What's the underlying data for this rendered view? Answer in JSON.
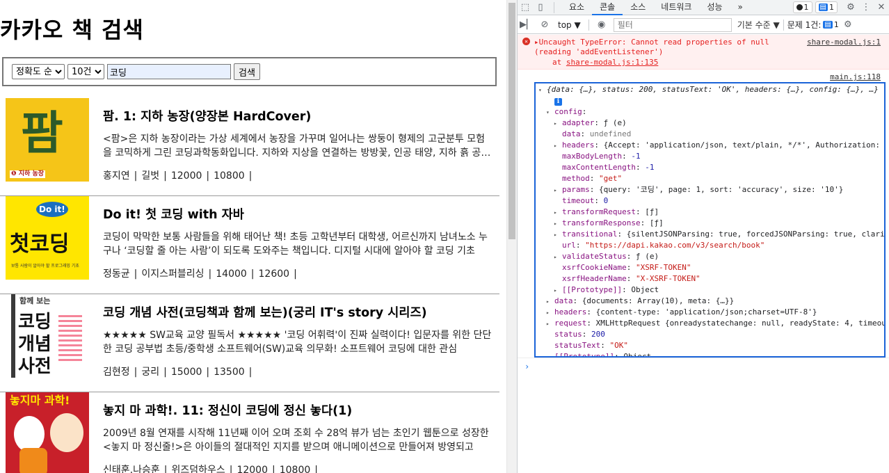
{
  "page": {
    "title": "카카오 책 검색",
    "search": {
      "sort_value": "정확도 순",
      "size_value": "10건",
      "query_value": "코딩",
      "submit_label": "검색"
    },
    "books": [
      {
        "title": "팜. 1: 지하 농장(양장본 HardCover)",
        "desc": "<팜>은 지하 농장이라는 가상 세계에서 농장을 가꾸며 일어나는 쌍둥이 형제의 고군분투 모험을 코믹하게 그린 코딩과학동화입니다. 지하와 지상을 연결하는 방방꽃, 인공 태양, 지하 흙 공장 등",
        "author": "홍지연",
        "publisher": "길벗",
        "price": "12000",
        "sale_price": "10800",
        "cover_text": "팜",
        "cover_sub": "❶ 지하 농장"
      },
      {
        "title": "Do it! 첫 코딩 with 자바",
        "desc": "코딩이 막막한 보통 사람들을 위해 태어난 책! 초등 고학년부터 대학생, 어르신까지 남녀노소 누구나 ‘코딩할 줄 아는 사람’이 되도록 도와주는 책입니다. 디지털 시대에 알아야 할 코딩 기초",
        "author": "정동균",
        "publisher": "이지스퍼블리싱",
        "price": "14000",
        "sale_price": "12600",
        "cover_badge": "Do it!",
        "cover_text": "첫코딩",
        "cover_sub": "보통 사람이 알아야 할 프로그래밍 기초"
      },
      {
        "title": "코딩 개념 사전(코딩책과 함께 보는)(궁리 IT's story 시리즈)",
        "desc": "★★★★★ SW교육 교양 필독서 ★★★★★ '코딩 어휘력'이 진짜 실력이다! 입문자를 위한 단단한 코딩 공부법 초등/중학생 소프트웨어(SW)교육 의무화! 소프트웨어 코딩에 대한 관심",
        "author": "김현정",
        "publisher": "궁리",
        "price": "15000",
        "sale_price": "13500",
        "cover_top": "함께 보는",
        "cover_text": "코딩 개념 사전"
      },
      {
        "title": "놓지 마 과학!. 11: 정신이 코딩에 정신 놓다(1)",
        "desc": "2009년 8월 연재를 시작해 11년째 이어 오며 조회 수 28억 뷰가 넘는 초인기 웹툰으로 성장한 <놓지 마 정신줄!>은 아이들의 절대적인 지지를 받으며 애니메이션으로 만들어져 방영되고",
        "author": "신태훈,나승훈",
        "publisher": "위즈덤하우스",
        "price": "12000",
        "sale_price": "10800",
        "cover_text": "놓지마 과학!"
      }
    ]
  },
  "devtools": {
    "tabs": [
      "요소",
      "콘솔",
      "소스",
      "네트워크",
      "성능",
      "»"
    ],
    "active_tab": "콘솔",
    "error_badge": "1",
    "msg_badge": "1",
    "toolbar": {
      "context": "top ▼",
      "filter_placeholder": "필터",
      "levels": "기본 수준 ▼",
      "issues_label": "문제 1건:",
      "issues_count": "1"
    },
    "error": {
      "line1": "▸Uncaught TypeError: Cannot read properties of null",
      "line2": "(reading 'addEventListener')",
      "at_label": "at",
      "at_src": "share-modal.js:1:135",
      "src": "share-modal.js:1"
    },
    "log_src": "main.js:118",
    "object_lines": [
      {
        "indent": 0,
        "tri": "▾",
        "text": "{data: {…}, status: 200, statusText: 'OK', headers: {…}, config: {…}, …}"
      },
      {
        "indent": 1,
        "tri": "",
        "text": "ℹ"
      },
      {
        "indent": 1,
        "tri": "▾",
        "key": "config",
        "text": ""
      },
      {
        "indent": 2,
        "tri": "▸",
        "key": "adapter",
        "text": "ƒ (e)"
      },
      {
        "indent": 2,
        "tri": "",
        "key": "data",
        "text": "undefined"
      },
      {
        "indent": 2,
        "tri": "▸",
        "key": "headers",
        "text": "{Accept: 'application/json, text/plain, */*', Authorization: 'K"
      },
      {
        "indent": 2,
        "tri": "",
        "key": "maxBodyLength",
        "text": "-1"
      },
      {
        "indent": 2,
        "tri": "",
        "key": "maxContentLength",
        "text": "-1"
      },
      {
        "indent": 2,
        "tri": "",
        "key": "method",
        "text": "\"get\""
      },
      {
        "indent": 2,
        "tri": "▸",
        "key": "params",
        "text": "{query: '코딩', page: 1, sort: 'accuracy', size: '10'}"
      },
      {
        "indent": 2,
        "tri": "",
        "key": "timeout",
        "text": "0"
      },
      {
        "indent": 2,
        "tri": "▸",
        "key": "transformRequest",
        "text": "[ƒ]"
      },
      {
        "indent": 2,
        "tri": "▸",
        "key": "transformResponse",
        "text": "[ƒ]"
      },
      {
        "indent": 2,
        "tri": "▸",
        "key": "transitional",
        "text": "{silentJSONParsing: true, forcedJSONParsing: true, clarif"
      },
      {
        "indent": 2,
        "tri": "",
        "key": "url",
        "text": "\"https://dapi.kakao.com/v3/search/book\""
      },
      {
        "indent": 2,
        "tri": "▸",
        "key": "validateStatus",
        "text": "ƒ (e)"
      },
      {
        "indent": 2,
        "tri": "",
        "key": "xsrfCookieName",
        "text": "\"XSRF-TOKEN\""
      },
      {
        "indent": 2,
        "tri": "",
        "key": "xsrfHeaderName",
        "text": "\"X-XSRF-TOKEN\""
      },
      {
        "indent": 2,
        "tri": "▸",
        "key": "[[Prototype]]",
        "text": "Object"
      },
      {
        "indent": 1,
        "tri": "▸",
        "key": "data",
        "text": "{documents: Array(10), meta: {…}}"
      },
      {
        "indent": 1,
        "tri": "▸",
        "key": "headers",
        "text": "{content-type: 'application/json;charset=UTF-8'}"
      },
      {
        "indent": 1,
        "tri": "▸",
        "key": "request",
        "text": "XMLHttpRequest {onreadystatechange: null, readyState: 4, timeout"
      },
      {
        "indent": 1,
        "tri": "",
        "key": "status",
        "text": "200"
      },
      {
        "indent": 1,
        "tri": "",
        "key": "statusText",
        "text": "\"OK\""
      },
      {
        "indent": 1,
        "tri": "▸",
        "key": "[[Prototype]]",
        "text": "Object"
      }
    ],
    "prompt": "›"
  }
}
